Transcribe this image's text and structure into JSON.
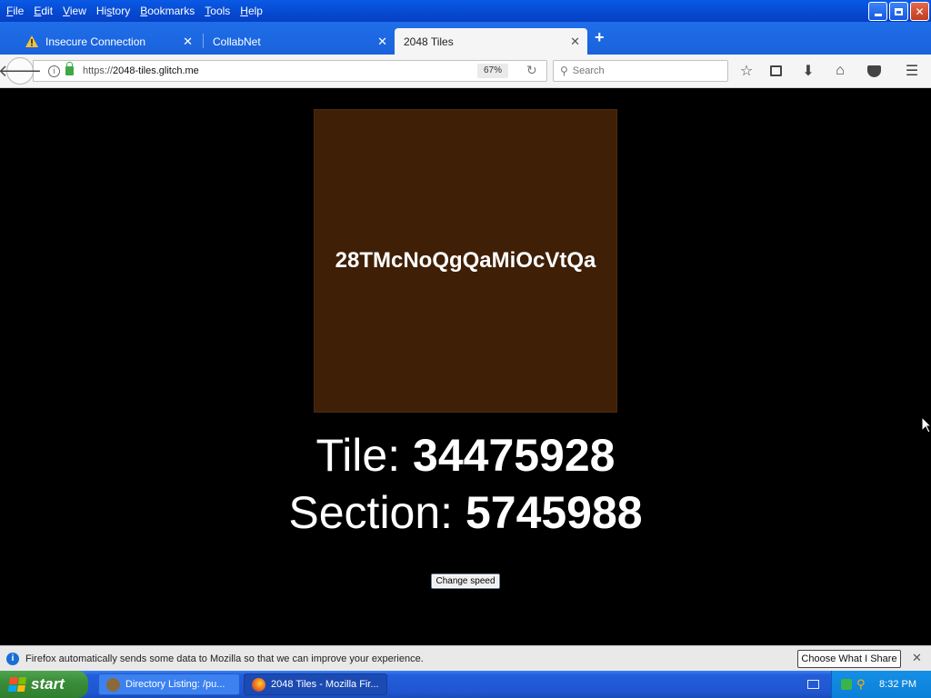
{
  "menu": {
    "items": [
      "File",
      "Edit",
      "View",
      "History",
      "Bookmarks",
      "Tools",
      "Help"
    ],
    "underline": [
      "F",
      "E",
      "V",
      "s",
      "B",
      "T",
      "H"
    ]
  },
  "tabs": [
    {
      "label": "Insecure Connection",
      "icon": "warning-icon"
    },
    {
      "label": "CollabNet",
      "icon": ""
    },
    {
      "label": "2048 Tiles",
      "icon": ""
    }
  ],
  "nav": {
    "url_prefix": "https://",
    "url_host": "2048-tiles.glitch.me",
    "zoom": "67%",
    "search_placeholder": "Search"
  },
  "page": {
    "tile_code": "28TMcNoQgQaMiOcVtQa",
    "tile_label": "Tile: ",
    "tile_value": "34475928",
    "section_label": "Section: ",
    "section_value": "5745988",
    "speed_button": "Change speed",
    "tile_color": "#3f1f05"
  },
  "notification": {
    "text": "Firefox automatically sends some data to Mozilla so that we can improve your experience.",
    "button": "Choose What I Share"
  },
  "taskbar": {
    "start": "start",
    "tasks": [
      {
        "label": "Directory Listing: /pu..."
      },
      {
        "label": "2048 Tiles - Mozilla Fir..."
      }
    ],
    "clock": "8:32 PM"
  }
}
